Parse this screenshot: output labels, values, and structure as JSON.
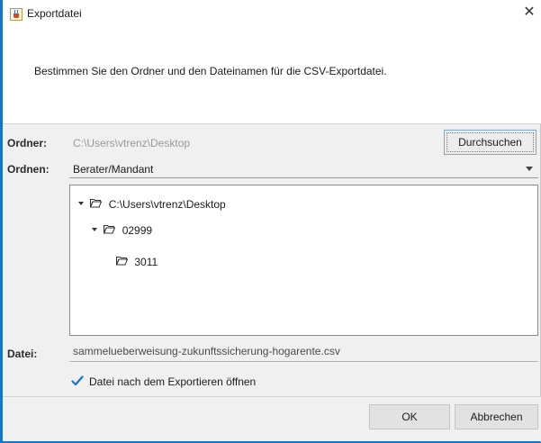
{
  "window": {
    "title": "Exportdatei",
    "close_glyph": "✕"
  },
  "header": {
    "text": "Bestimmen Sie den Ordner und den Dateinamen für die CSV-Exportdatei."
  },
  "folder": {
    "label": "Ordner:",
    "path": "C:\\Users\\vtrenz\\Desktop",
    "browse_label": "Durchsuchen"
  },
  "sort": {
    "label": "Ordnen:",
    "value": "Berater/Mandant"
  },
  "tree": {
    "nodes": [
      {
        "label": "C:\\Users\\vtrenz\\Desktop",
        "expanded": true,
        "icon": "folder-open-icon"
      },
      {
        "label": "02999",
        "expanded": true,
        "icon": "folder-open-icon"
      },
      {
        "label": "3011",
        "expanded": false,
        "icon": "folder-open-icon"
      }
    ]
  },
  "file": {
    "label": "Datei:",
    "value": "sammelueberweisung-zukunftssicherung-hogarente.csv"
  },
  "open_after_export": {
    "label": "Datei nach dem Exportieren öffnen",
    "checked": true
  },
  "buttons": {
    "ok": "OK",
    "cancel": "Abbrechen"
  },
  "colors": {
    "accent": "#1a73c6",
    "checkmark": "#1a73c6"
  }
}
